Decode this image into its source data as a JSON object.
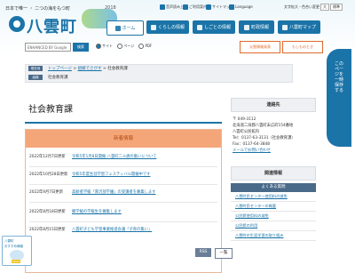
{
  "header": {
    "tagline": "日本で唯一 ・ 二つの海をもつ町",
    "town_name": "八雲町",
    "anniversary_year": "2018",
    "util_links": [
      "音声読み上げ",
      "ご利用案内",
      "サイトマップ",
      "Language"
    ],
    "text_size_label": "文字拡大・色合い変更",
    "text_size_buttons": [
      "大",
      "標準"
    ]
  },
  "gnav": [
    {
      "label": "ホーム",
      "icon": "home-icon"
    },
    {
      "label": "くらしの情報",
      "icon": "life-icon"
    },
    {
      "label": "しごとの情報",
      "icon": "work-icon"
    },
    {
      "label": "町政情報",
      "icon": "town-icon"
    },
    {
      "label": "八雲町マップ",
      "icon": "map-icon"
    }
  ],
  "search": {
    "placeholder": "ENHANCED BY Google",
    "button": "検索",
    "options": [
      "サイト",
      "ページ",
      "PDF"
    ]
  },
  "banners": [
    "災害情報発表",
    "もしものとき"
  ],
  "breadcrumb": {
    "current_tag": "現在地",
    "items": [
      "トップページ",
      "組織でさがす",
      "社会教育課"
    ],
    "org_tag": "組織",
    "org_name": "社会教育課"
  },
  "page_title": "社会教育課",
  "news": {
    "heading": "新着情報",
    "items": [
      {
        "date": "2022年12月7日更新",
        "title": "令和5年1月8日開催 八雲町二十歳の集いについて"
      },
      {
        "date": "2022年10月28日更新",
        "title": "令和5年度生涯学習フェスティバル開催中です"
      },
      {
        "date": "2022年9月7日更新",
        "title": "高齢者学級「厚沢部学園」の受講者を募集します"
      },
      {
        "date": "2022年8月18日更新",
        "title": "郷学級の学級生を募集します"
      },
      {
        "date": "2022年8月15日更新",
        "title": "八雲町子ども学習事業推進会議「子育の集い」"
      }
    ],
    "rss": "RSS",
    "list": "一覧"
  },
  "contact": {
    "heading": "連絡先",
    "lines": [
      "〒 049-3112",
      "北海道二海郡八雲町末広町154番地",
      "八雲町公民館内",
      "Tel：0137-63-3131（社会教育課）",
      "Fax：0137-64-3848"
    ],
    "link": "メールでお問い合わせ"
  },
  "related": {
    "heading": "関連情報",
    "sub": "よくある質問",
    "items": [
      "八雲町民センター使用料の減免",
      "八雲町民センターの概要",
      "公民館使用料の減免",
      "公民館の利用",
      "八雲町の生涯学習の取り組み"
    ]
  },
  "side_tab": "このページを一時保存する",
  "mascot": {
    "line1": "八雲町",
    "line2": "おすすめ情報",
    "badge": "Open"
  }
}
